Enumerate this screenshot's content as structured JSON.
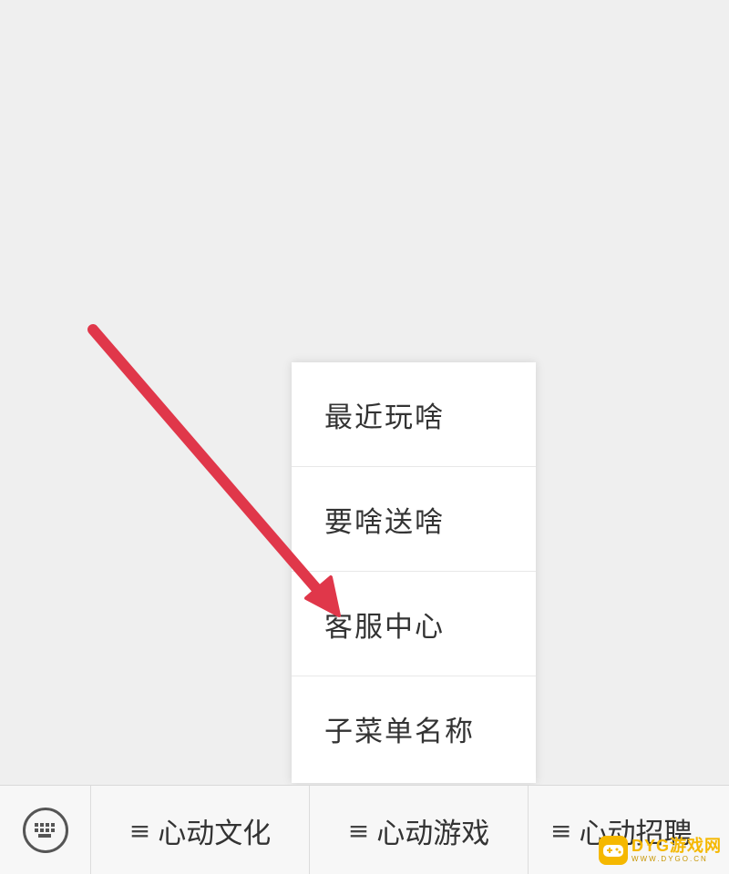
{
  "menu": {
    "items": [
      {
        "label": "最近玩啥"
      },
      {
        "label": "要啥送啥"
      },
      {
        "label": "客服中心"
      },
      {
        "label": "子菜单名称"
      }
    ]
  },
  "bottom_bar": {
    "keyboard_icon": "keyboard-icon",
    "tabs": [
      {
        "icon": "≡",
        "label": "心动文化"
      },
      {
        "icon": "≡",
        "label": "心动游戏"
      },
      {
        "icon": "≡",
        "label": "心动招聘"
      }
    ]
  },
  "annotation": {
    "arrow_color": "#e0374a"
  },
  "watermark": {
    "main": "DYG游戏网",
    "sub": "WWW.DYGO.CN",
    "color": "#f5b800"
  }
}
